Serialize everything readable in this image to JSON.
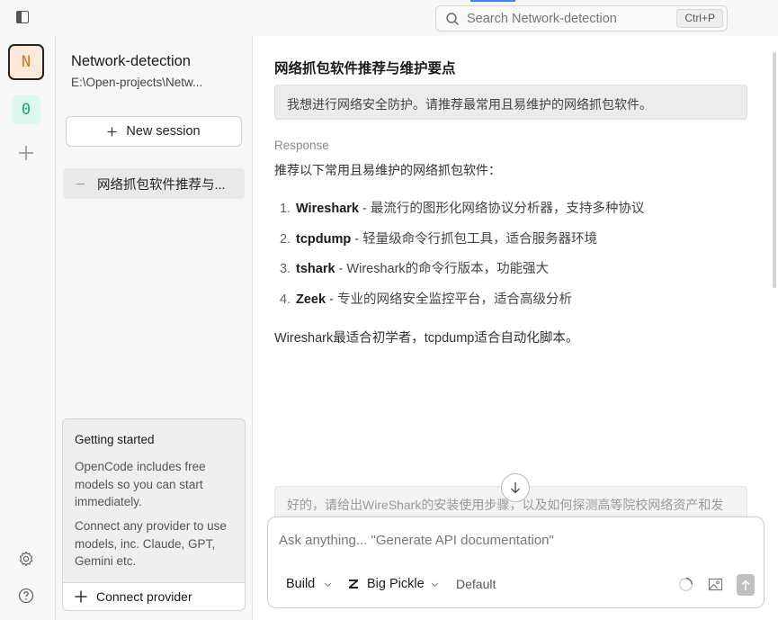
{
  "titlebar": {
    "search_placeholder": "Search Network-detection",
    "search_shortcut": "Ctrl+P"
  },
  "rail": {
    "projects": [
      {
        "initial": "N",
        "bg": "#fde8dc",
        "fg": "#e0701d"
      },
      {
        "initial": "0",
        "bg": "#def7ef",
        "fg": "#15a37a"
      }
    ]
  },
  "panel": {
    "project_name": "Network-detection",
    "project_path": "E:\\Open-projects\\Netw...",
    "new_session_label": "New session",
    "sessions": [
      {
        "title": "网络抓包软件推荐与..."
      }
    ],
    "getting_started": {
      "title": "Getting started",
      "paragraph1": "OpenCode includes free models so you can start immediately.",
      "paragraph2": "Connect any provider to use models, inc. Claude, GPT, Gemini etc.",
      "connect_label": "Connect provider"
    }
  },
  "main": {
    "conversation_title": "网络抓包软件推荐与维护要点",
    "user_message": "我想进行网络安全防护。请推荐最常用且易维护的网络抓包软件。",
    "response_label": "Response",
    "response_intro": "推荐以下常用且易维护的网络抓包软件：",
    "response_items": [
      {
        "num": "1.",
        "name": "Wireshark",
        "desc": " - 最流行的图形化网络协议分析器，支持多种协议"
      },
      {
        "num": "2.",
        "name": "tcpdump",
        "desc": " - 轻量级命令行抓包工具，适合服务器环境"
      },
      {
        "num": "3.",
        "name": "tshark",
        "desc": " - Wireshark的命令行版本，功能强大"
      },
      {
        "num": "4.",
        "name": "Zeek",
        "desc": " - 专业的网络安全监控平台，适合高级分析"
      }
    ],
    "response_summary": "Wireshark最适合初学者，tcpdump适合自动化脚本。",
    "queued_message": "好的，请给出WireShark的安装使用步骤，以及如何探测高等院校网络资产和发"
  },
  "prompt": {
    "placeholder": "Ask anything... \"Generate API documentation\"",
    "agent": "Build",
    "model": "Big Pickle",
    "variant": "Default"
  }
}
